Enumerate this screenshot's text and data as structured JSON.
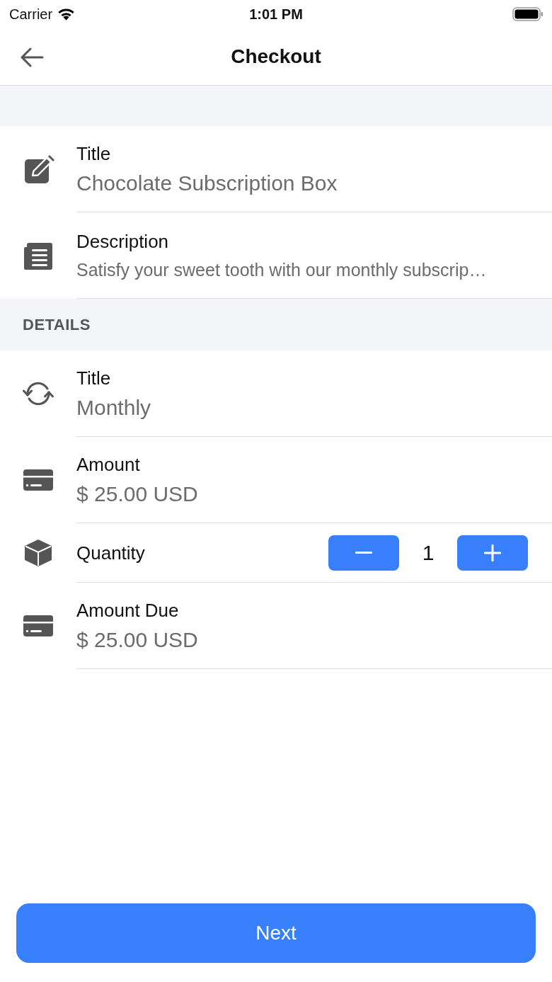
{
  "status_bar": {
    "carrier": "Carrier",
    "time": "1:01 PM"
  },
  "nav_bar": {
    "title": "Checkout"
  },
  "summary": {
    "rows": [
      {
        "kind": "title",
        "label": "Title",
        "value": "Chocolate Subscription Box"
      },
      {
        "kind": "description",
        "label": "Description",
        "value": "Satisfy your sweet tooth with our monthly subscrip…"
      }
    ]
  },
  "details": {
    "header": "DETAILS",
    "rows": [
      {
        "kind": "interval",
        "label": "Title",
        "value": "Monthly"
      },
      {
        "kind": "amount",
        "label": "Amount",
        "value": "$ 25.00 USD"
      },
      {
        "kind": "quantity",
        "label": "Quantity",
        "value": "1"
      },
      {
        "kind": "total",
        "label": "Amount Due",
        "value": "$ 25.00 USD"
      }
    ]
  },
  "primary_button": {
    "label": "Next"
  }
}
